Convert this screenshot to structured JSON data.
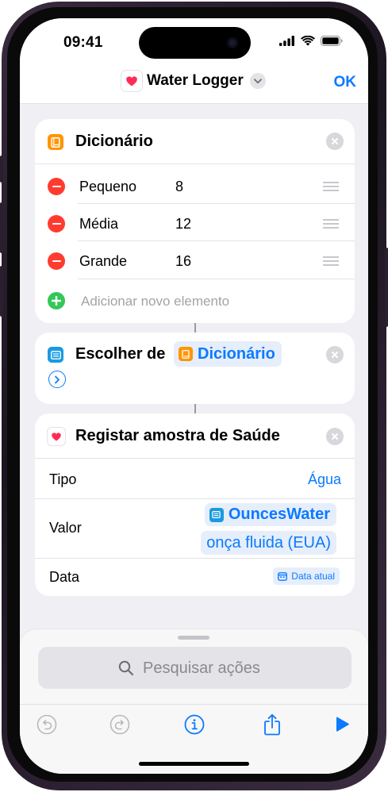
{
  "status_bar": {
    "time": "09:41"
  },
  "navbar": {
    "title": "Water Logger",
    "done_label": "OK"
  },
  "dictionary_card": {
    "title": "Dicionário",
    "rows": [
      {
        "key": "Pequeno",
        "value": "8"
      },
      {
        "key": "Média",
        "value": "12"
      },
      {
        "key": "Grande",
        "value": "16"
      }
    ],
    "add_label": "Adicionar novo elemento"
  },
  "choose_card": {
    "title": "Escolher de",
    "token": "Dicionário"
  },
  "health_card": {
    "title": "Registar amostra de Saúde",
    "type_label": "Tipo",
    "type_value": "Água",
    "value_label": "Valor",
    "value_token": "OuncesWater",
    "unit_token": "onça fluida (EUA)",
    "date_label": "Data",
    "date_token": "Data atual"
  },
  "bottom_sheet": {
    "search_placeholder": "Pesquisar ações"
  },
  "colors": {
    "accent": "#0a7aff",
    "delete": "#ff3b30",
    "add": "#34c759",
    "dictionary_orange": "#ff9500"
  }
}
